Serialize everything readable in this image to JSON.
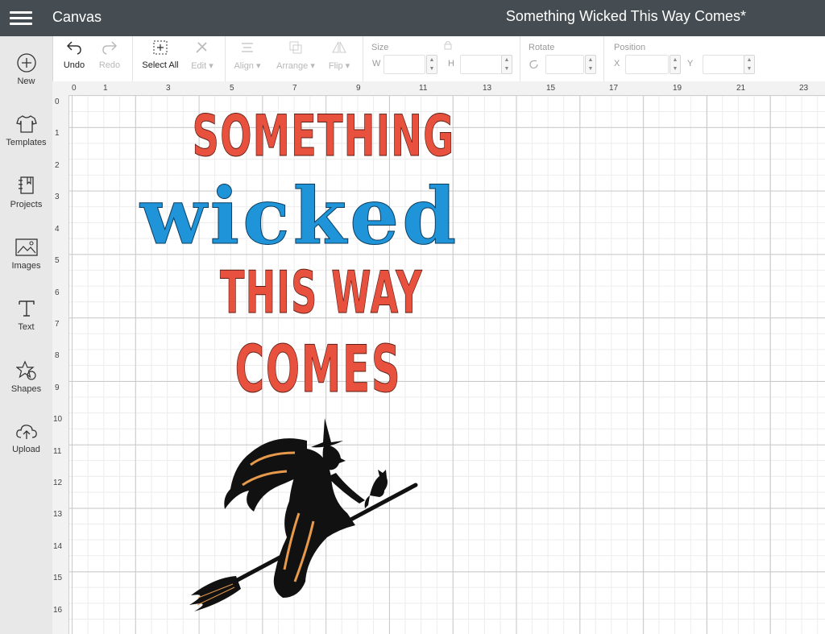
{
  "header": {
    "app_title": "Canvas",
    "document_title": "Something Wicked This Way Comes*"
  },
  "toolbar": {
    "undo": "Undo",
    "redo": "Redo",
    "select_all": "Select All",
    "edit": "Edit",
    "align": "Align",
    "arrange": "Arrange",
    "flip": "Flip",
    "size_label": "Size",
    "w_label": "W",
    "h_label": "H",
    "rotate_label": "Rotate",
    "position_label": "Position",
    "x_label": "X",
    "y_label": "Y"
  },
  "sidebar": {
    "items": [
      {
        "label": "New",
        "icon": "plus-circle-icon"
      },
      {
        "label": "Templates",
        "icon": "tshirt-icon"
      },
      {
        "label": "Projects",
        "icon": "notebook-icon"
      },
      {
        "label": "Images",
        "icon": "image-icon"
      },
      {
        "label": "Text",
        "icon": "text-icon"
      },
      {
        "label": "Shapes",
        "icon": "shapes-icon"
      },
      {
        "label": "Upload",
        "icon": "cloud-upload-icon"
      }
    ]
  },
  "ruler": {
    "top": [
      "0",
      "1",
      "3",
      "5",
      "7",
      "9",
      "11",
      "13",
      "15",
      "17",
      "19",
      "21",
      "23"
    ],
    "left": [
      "0",
      "1",
      "2",
      "3",
      "4",
      "5",
      "6",
      "7",
      "8",
      "9",
      "10",
      "11",
      "12",
      "13",
      "14",
      "15",
      "16"
    ]
  },
  "design": {
    "lines": [
      "SOMETHING",
      "wicked",
      "THIS WAY",
      "COMES"
    ],
    "colors": {
      "red": "#e8513e",
      "blue": "#1f94d8",
      "witch_black": "#111111",
      "witch_orange": "#e79a4b"
    }
  },
  "colors": {
    "header_bg": "#454d52",
    "sidebar_bg": "#e8e8e8"
  }
}
